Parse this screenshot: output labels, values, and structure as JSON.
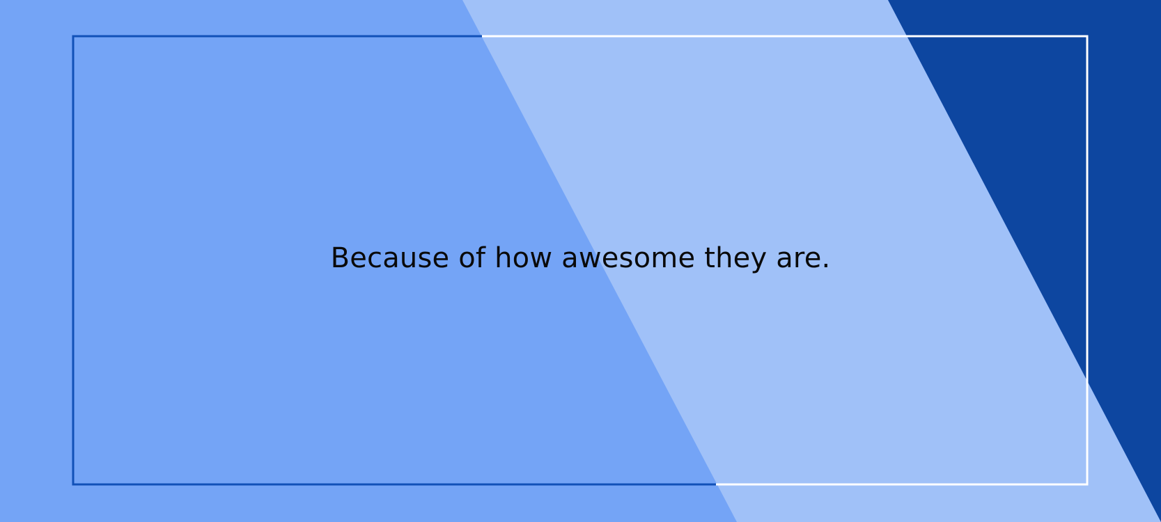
{
  "slide": {
    "body_text": "Because of how awesome they are."
  },
  "colors": {
    "base_blue": "#74a4f6",
    "light_band": "#a0c1f8",
    "dark_blue": "#0d46a0",
    "frame_dark": "#1151b8",
    "frame_light": "#ffffff",
    "text": "#0a0a0a"
  }
}
